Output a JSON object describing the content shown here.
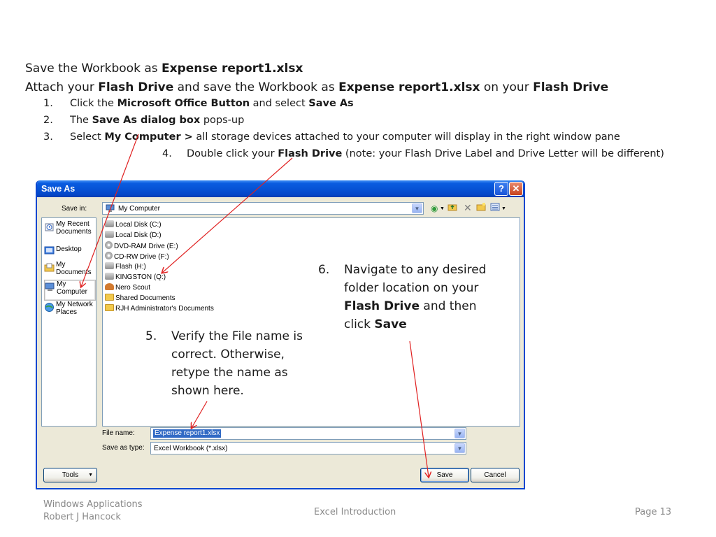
{
  "instructions": {
    "line1": {
      "prefix": "Save the Workbook as ",
      "bold": "Expense report1.xlsx"
    },
    "line2": {
      "a": "Attach your ",
      "b": "Flash Drive",
      "c": " and save the Workbook as ",
      "d": "Expense report1.xlsx",
      "e": " on your ",
      "f": "Flash Drive"
    },
    "steps": [
      {
        "num": "1.",
        "a": "Click the ",
        "b": "Microsoft Office Button",
        "c": " and select ",
        "d": "Save As"
      },
      {
        "num": "2.",
        "a": "The ",
        "b": "Save As dialog box",
        "c": " pops-up"
      },
      {
        "num": "3.",
        "a": "Select ",
        "b": "My Computer >",
        "c": " all storage devices attached to your computer will display in the right window pane"
      },
      {
        "num": "4.",
        "a": "Double click your ",
        "b": "Flash Drive",
        "c": " (note: your Flash Drive Label and Drive Letter will be different)"
      }
    ]
  },
  "dialog": {
    "title": "Save As",
    "help_glyph": "?",
    "close_glyph": "✕",
    "save_in_label": "Save in:",
    "save_in_value": "My Computer",
    "toolbar_icons": [
      "back-icon",
      "up-folder-icon",
      "delete-icon",
      "new-folder-icon",
      "views-icon"
    ],
    "places": [
      {
        "label": "My Recent Documents",
        "icon": "recent-documents-icon"
      },
      {
        "label": "Desktop",
        "icon": "desktop-icon"
      },
      {
        "label": "My Documents",
        "icon": "my-documents-icon"
      },
      {
        "label": "My Computer",
        "icon": "my-computer-icon"
      },
      {
        "label": "My Network Places",
        "icon": "network-places-icon"
      }
    ],
    "items": [
      "Local Disk (C:)",
      "Local Disk (D:)",
      "DVD-RAM Drive (E:)",
      "CD-RW Drive (F:)",
      "Flash (H:)",
      "KINGSTON (Q:)",
      "Nero Scout",
      "Shared Documents",
      "RJH Administrator's Documents"
    ],
    "file_name_label": "File name:",
    "file_name_value": "Expense report1.xlsx",
    "save_type_label": "Save as type:",
    "save_type_value": "Excel Workbook (*.xlsx)",
    "tools_label": "Tools",
    "save_label": "Save",
    "cancel_label": "Cancel",
    "colors": {
      "titlebar": "#0653d6",
      "face": "#ece9d8",
      "selection": "#316ac5"
    }
  },
  "annotations": {
    "step5": {
      "num": "5.",
      "text": "Verify the File name is correct.  Otherwise, retype the name as shown here."
    },
    "step6": {
      "num": "6.",
      "a": "Navigate to any desired folder location on your ",
      "b": "Flash Drive",
      "c": " and then click ",
      "d": "Save"
    }
  },
  "footer": {
    "left_line1": "Windows Applications",
    "left_line2": "Robert J Hancock",
    "center": "Excel Introduction",
    "right": "Page 13"
  }
}
